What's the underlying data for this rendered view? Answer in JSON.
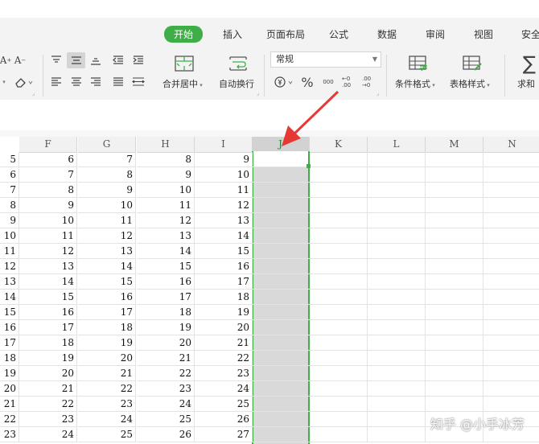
{
  "tabs": [
    {
      "label": "开始",
      "active": true
    },
    {
      "label": "插入"
    },
    {
      "label": "页面布局"
    },
    {
      "label": "公式"
    },
    {
      "label": "数据"
    },
    {
      "label": "审阅"
    },
    {
      "label": "视图"
    },
    {
      "label": "安全"
    }
  ],
  "ribbon": {
    "merge_label": "合并居中",
    "wrap_label": "自动换行",
    "number_format_value": "常规",
    "conditional_label": "条件格式",
    "table_style_label": "表格样式",
    "sum_label": "求和",
    "font_grow": "A",
    "font_shrink": "A",
    "percent_symbol": "%",
    "thousands_symbol": "000",
    "dec_increase": "←0 .00",
    "dec_decrease": ".00 →0"
  },
  "columns": [
    "F",
    "G",
    "H",
    "I",
    "J",
    "K",
    "L",
    "M",
    "N"
  ],
  "selected_column": "J",
  "rows": [
    [
      5,
      6,
      7,
      8,
      9
    ],
    [
      6,
      7,
      8,
      9,
      10
    ],
    [
      7,
      8,
      9,
      10,
      11
    ],
    [
      8,
      9,
      10,
      11,
      12
    ],
    [
      9,
      10,
      11,
      12,
      13
    ],
    [
      10,
      11,
      12,
      13,
      14
    ],
    [
      11,
      12,
      13,
      14,
      15
    ],
    [
      12,
      13,
      14,
      15,
      16
    ],
    [
      13,
      14,
      15,
      16,
      17
    ],
    [
      14,
      15,
      16,
      17,
      18
    ],
    [
      15,
      16,
      17,
      18,
      19
    ],
    [
      16,
      17,
      18,
      19,
      20
    ],
    [
      17,
      18,
      19,
      20,
      21
    ],
    [
      18,
      19,
      20,
      21,
      22
    ],
    [
      19,
      20,
      21,
      22,
      23
    ],
    [
      20,
      21,
      22,
      23,
      24
    ],
    [
      21,
      22,
      23,
      24,
      25
    ],
    [
      22,
      23,
      24,
      25,
      26
    ],
    [
      23,
      24,
      25,
      26,
      27
    ]
  ],
  "watermark": "知乎 @小手冰芳",
  "colors": {
    "accent": "#3fae49",
    "selection": "#d9d9d9",
    "annotation_arrow": "#e53935"
  }
}
